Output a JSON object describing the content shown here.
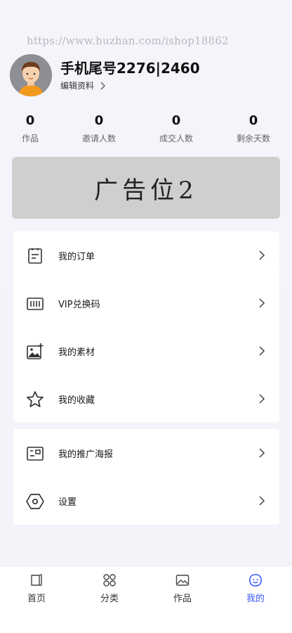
{
  "watermark": "https://www.huzhan.com/ishop18862",
  "profile": {
    "username": "手机尾号2276|2460",
    "edit_label": "编辑资料"
  },
  "stats": [
    {
      "value": "0",
      "label": "作品"
    },
    {
      "value": "0",
      "label": "邀请人数"
    },
    {
      "value": "0",
      "label": "成交人数"
    },
    {
      "value": "0",
      "label": "剩余天数"
    }
  ],
  "banner": {
    "text": "广告位2"
  },
  "menu_primary": [
    {
      "label": "我的订单",
      "icon": "order-icon"
    },
    {
      "label": "VIP兑换码",
      "icon": "barcode-icon"
    },
    {
      "label": "我的素材",
      "icon": "image-add-icon"
    },
    {
      "label": "我的收藏",
      "icon": "star-icon"
    }
  ],
  "menu_secondary": [
    {
      "label": "我的推广海报",
      "icon": "poster-icon"
    },
    {
      "label": "设置",
      "icon": "settings-icon"
    }
  ],
  "tabbar": [
    {
      "label": "首页",
      "icon": "home-icon"
    },
    {
      "label": "分类",
      "icon": "grid-icon"
    },
    {
      "label": "作品",
      "icon": "picture-icon"
    },
    {
      "label": "我的",
      "icon": "profile-icon",
      "active": true
    }
  ],
  "colors": {
    "accent": "#3b5bff",
    "background": "#f4f5fb",
    "banner": "#cfcfcf"
  }
}
